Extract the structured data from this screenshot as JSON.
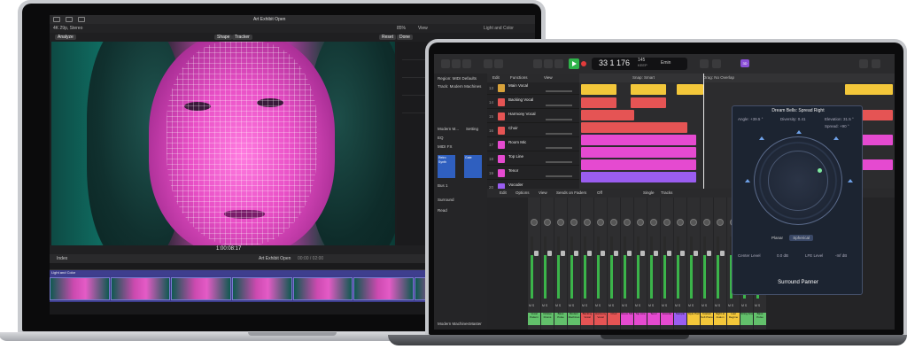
{
  "fcp": {
    "window_title": "Art Exhibit Open",
    "resolution": "4K 29p, Stereo",
    "zoom": "85%",
    "view_label": "View",
    "inspector_label": "Light and Color",
    "analyze_label": "Analyze",
    "shape_label": "Shape",
    "tracker_label": "Tracker",
    "reset_label": "Reset",
    "done_label": "Done",
    "timecode": "1:00:08:17",
    "index_label": "Index",
    "timeline_name": "Art Exhibit Open",
    "timeline_timecode": "00:00 / 02:00",
    "track_label": "Light and Color"
  },
  "logic": {
    "lcd_bar": "33 1",
    "lcd_beat": "176",
    "lcd_tempo": "145",
    "lcd_tempo_sub": "KEEP",
    "lcd_key": "Emin",
    "region_label": "Region: MIDI Defaults",
    "track_label": "Track: Modern Machines",
    "edit_label": "Edit",
    "functions_label": "Functions",
    "view_label": "View",
    "snap_label": "Snap:",
    "snap_value": "Smart",
    "drag_label": "Drag:",
    "drag_value": "No Overlap",
    "tracks": [
      {
        "num": "13",
        "name": "Main Vocal"
      },
      {
        "num": "14",
        "name": "Backing Vocal"
      },
      {
        "num": "15",
        "name": "Harmony Vocal"
      },
      {
        "num": "16",
        "name": "Choir"
      },
      {
        "num": "17",
        "name": "Room Mic"
      },
      {
        "num": "18",
        "name": "Top Line"
      },
      {
        "num": "19",
        "name": "Tenor"
      },
      {
        "num": "20",
        "name": "Vocoder"
      }
    ],
    "mixer_menu": {
      "edit": "Edit",
      "options": "Options",
      "view": "View",
      "sends": "Sends on Faders",
      "off": "Off",
      "single": "Single",
      "tracks": "Tracks"
    },
    "strips": [
      {
        "name": "Vocal Pattern",
        "color": "#62c06b"
      },
      {
        "name": "Octave Drums",
        "color": "#62c06b"
      },
      {
        "name": "Bass Pulse",
        "color": "#62c06b"
      },
      {
        "name": "Modern Machines",
        "color": "#62c06b"
      },
      {
        "name": "Backing Vocal",
        "color": "#e55454"
      },
      {
        "name": "Harmony Vocal",
        "color": "#e55454"
      },
      {
        "name": "Choir",
        "color": "#e55454"
      },
      {
        "name": "Room Mic",
        "color": "#e54ad0"
      },
      {
        "name": "Top Line",
        "color": "#e54ad0"
      },
      {
        "name": "Tenor",
        "color": "#e54ad0"
      },
      {
        "name": "Vocoder",
        "color": "#e54ad0"
      },
      {
        "name": "Sample",
        "color": "#9a5df0"
      },
      {
        "name": "Style Pad",
        "color": "#f3c73a"
      },
      {
        "name": "Custom Soft Piano",
        "color": "#f3c73a"
      },
      {
        "name": "Night at Avalon",
        "color": "#f3c73a"
      },
      {
        "name": "Last Regime",
        "color": "#f3c73a"
      },
      {
        "name": "String Ana",
        "color": "#62c06b"
      },
      {
        "name": "Bass Pulse",
        "color": "#62c06b"
      }
    ],
    "panner": {
      "title": "Dream Bells: Spread Right",
      "angle": "Angle: +39.5 °",
      "diversity": "Diversity: 0.41",
      "elevation": "Elevation: 31.5 °",
      "spread": "Spread: +90 °",
      "mode_planar": "Planar",
      "mode_spherical": "Spherical",
      "center_level": "Center Level",
      "center_value": "0.0 dB",
      "lfe_level": "LFE Level",
      "lfe_value": "-Inf dB",
      "footer": "Surround Panner"
    },
    "inspector": {
      "modern_label": "Modern M...",
      "setting": "Setting",
      "eq": "EQ",
      "midi_fx": "MIDI FX",
      "gate": "Gate",
      "plugins": "Retro Synth",
      "bus": "Bus 1",
      "surround": "Surround",
      "read": "Read",
      "footer_left": "Modern Machines",
      "footer_right": "Master"
    }
  }
}
